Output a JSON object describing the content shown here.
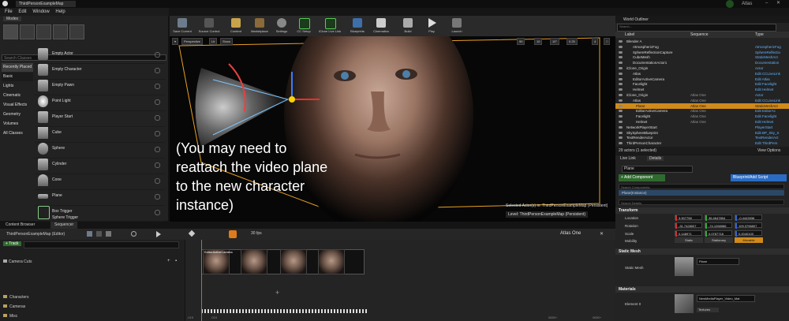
{
  "window": {
    "title": "ThirdPersonExampleMap",
    "project": "Atlas"
  },
  "menu": [
    "File",
    "Edit",
    "Window",
    "Help"
  ],
  "modes": {
    "panel_title": "Modes",
    "search_placeholder": "Search Classes",
    "categories": [
      "Recently Placed",
      "Basic",
      "Lights",
      "Cinematic",
      "Visual Effects",
      "Geometry",
      "Volumes",
      "All Classes"
    ],
    "items": [
      "Empty Actor",
      "Empty Character",
      "Empty Pawn",
      "Point Light",
      "Player Start",
      "Cube",
      "Sphere",
      "Cylinder",
      "Cone",
      "Plane",
      "Box Trigger",
      "Sphere Trigger"
    ]
  },
  "toolbar": {
    "buttons": [
      "Save Current",
      "Source Control",
      "Content",
      "Marketplace",
      "Settings",
      "CC Setup",
      "iClone Live Link",
      "Blueprints",
      "Cinematics",
      "Build",
      "Play",
      "Launch"
    ]
  },
  "viewport": {
    "perspective": "Perspective",
    "lit": "Lit",
    "show": "Show",
    "fov": "90",
    "grid": "10",
    "rot": "10°",
    "scale": "0.25",
    "cam": "4",
    "caption": "(You may need to reattach the video plane to the new character instance)",
    "selected_actor": "Selected Actor(s) in:  ThirdPersonExampleMap (Persistent)",
    "level": "Level:  ThirdPersonExampleMap (Persistent)"
  },
  "bottom": {
    "tabs": [
      "Content Browser",
      "Sequencer"
    ],
    "sequence_name": "ThirdPersonExampleMap (Editor)",
    "track_button": "+ Track",
    "search_placeholder": "Search Tracks",
    "fps": "30 fps",
    "sequence_title": "Atlas One",
    "camera_cuts": "Camera Cuts",
    "folders": [
      "Characters",
      "Cameras",
      "Misc"
    ],
    "shot_label": "EditorActiveCamera",
    "time_markers": [
      "-015",
      "-015",
      "0650+",
      "0650+"
    ]
  },
  "outliner": {
    "title": "World Outliner",
    "search_placeholder": "Search...",
    "columns": [
      "Label",
      "Sequence",
      "Type"
    ],
    "rows": [
      {
        "label": "Blender A",
        "seq": "",
        "type": ""
      },
      {
        "label": "AtmosphericFog",
        "seq": "",
        "type": "AtmosphericFog"
      },
      {
        "label": "SphereReflectionCapture",
        "seq": "",
        "type": "SphereReflectio"
      },
      {
        "label": "CubeMesh",
        "seq": "",
        "type": "StaticMeshAct"
      },
      {
        "label": "DocumentationActor1",
        "seq": "",
        "type": "Documentation"
      },
      {
        "label": "iClone_Origin",
        "seq": "",
        "type": "Actor"
      },
      {
        "label": "Atlas",
        "seq": "",
        "type": "Edit CCLiveLink"
      },
      {
        "label": "EditorActiveCamera",
        "seq": "",
        "type": "Edit Atlas"
      },
      {
        "label": "Facelight",
        "seq": "",
        "type": "Edit Facelight"
      },
      {
        "label": "Helmet",
        "seq": "",
        "type": "Edit Helmet"
      },
      {
        "label": "iClone_Origin",
        "seq": "Atlas One",
        "type": "Actor"
      },
      {
        "label": "Atlas",
        "seq": "Atlas One",
        "type": "Edit CCLiveLink"
      },
      {
        "label": "Plane",
        "seq": "Atlas One",
        "type": "StaticMeshAct",
        "selected": true
      },
      {
        "label": "EditorActiveCamera",
        "seq": "Atlas One",
        "type": "Edit EditorAc"
      },
      {
        "label": "Facelight",
        "seq": "Atlas One",
        "type": "Edit Facelight"
      },
      {
        "label": "Helmet",
        "seq": "Atlas One",
        "type": "Edit Helmet"
      },
      {
        "label": "NetworkPlayerStart",
        "seq": "",
        "type": "PlayerStart"
      },
      {
        "label": "SkySphereBlueprint",
        "seq": "",
        "type": "Edit BP_Sky_S"
      },
      {
        "label": "TextRenderActor",
        "seq": "",
        "type": "TextRenderAct"
      },
      {
        "label": "ThirdPersonCharacter",
        "seq": "",
        "type": "Edit ThirdPers"
      }
    ],
    "footer_count": "29 actors (1 selected)",
    "view_options": "View Options"
  },
  "details": {
    "tabs": [
      "Live Link",
      "Details"
    ],
    "actor_name": "Plane",
    "add_component": "+ Add Component",
    "blueprint": "Blueprint/Add Script",
    "search_components": "Search Components",
    "component": "Plane(Instance)",
    "search_details": "Search Details",
    "transform_header": "Transform",
    "location_label": "Location",
    "location": [
      "3.907758",
      "36.4647854",
      "-0.4443936"
    ],
    "rotation_label": "Rotation",
    "rotation": [
      "-31.7428007",
      "-74.1266986",
      "109.3796807"
    ],
    "scale_label": "Scale",
    "scale": [
      "0.148971",
      "0.0787718",
      "0.2040103"
    ],
    "mobility_label": "Mobility",
    "mobility": [
      "Static",
      "Stationary",
      "Movable"
    ],
    "static_mesh_header": "Static Mesh",
    "static_mesh_label": "Static Mesh",
    "static_mesh_value": "Plane",
    "materials_header": "Materials",
    "element_label": "Element 0",
    "material_value": "NewMediaPlayer_Video_Mat",
    "textures": "Textures"
  }
}
